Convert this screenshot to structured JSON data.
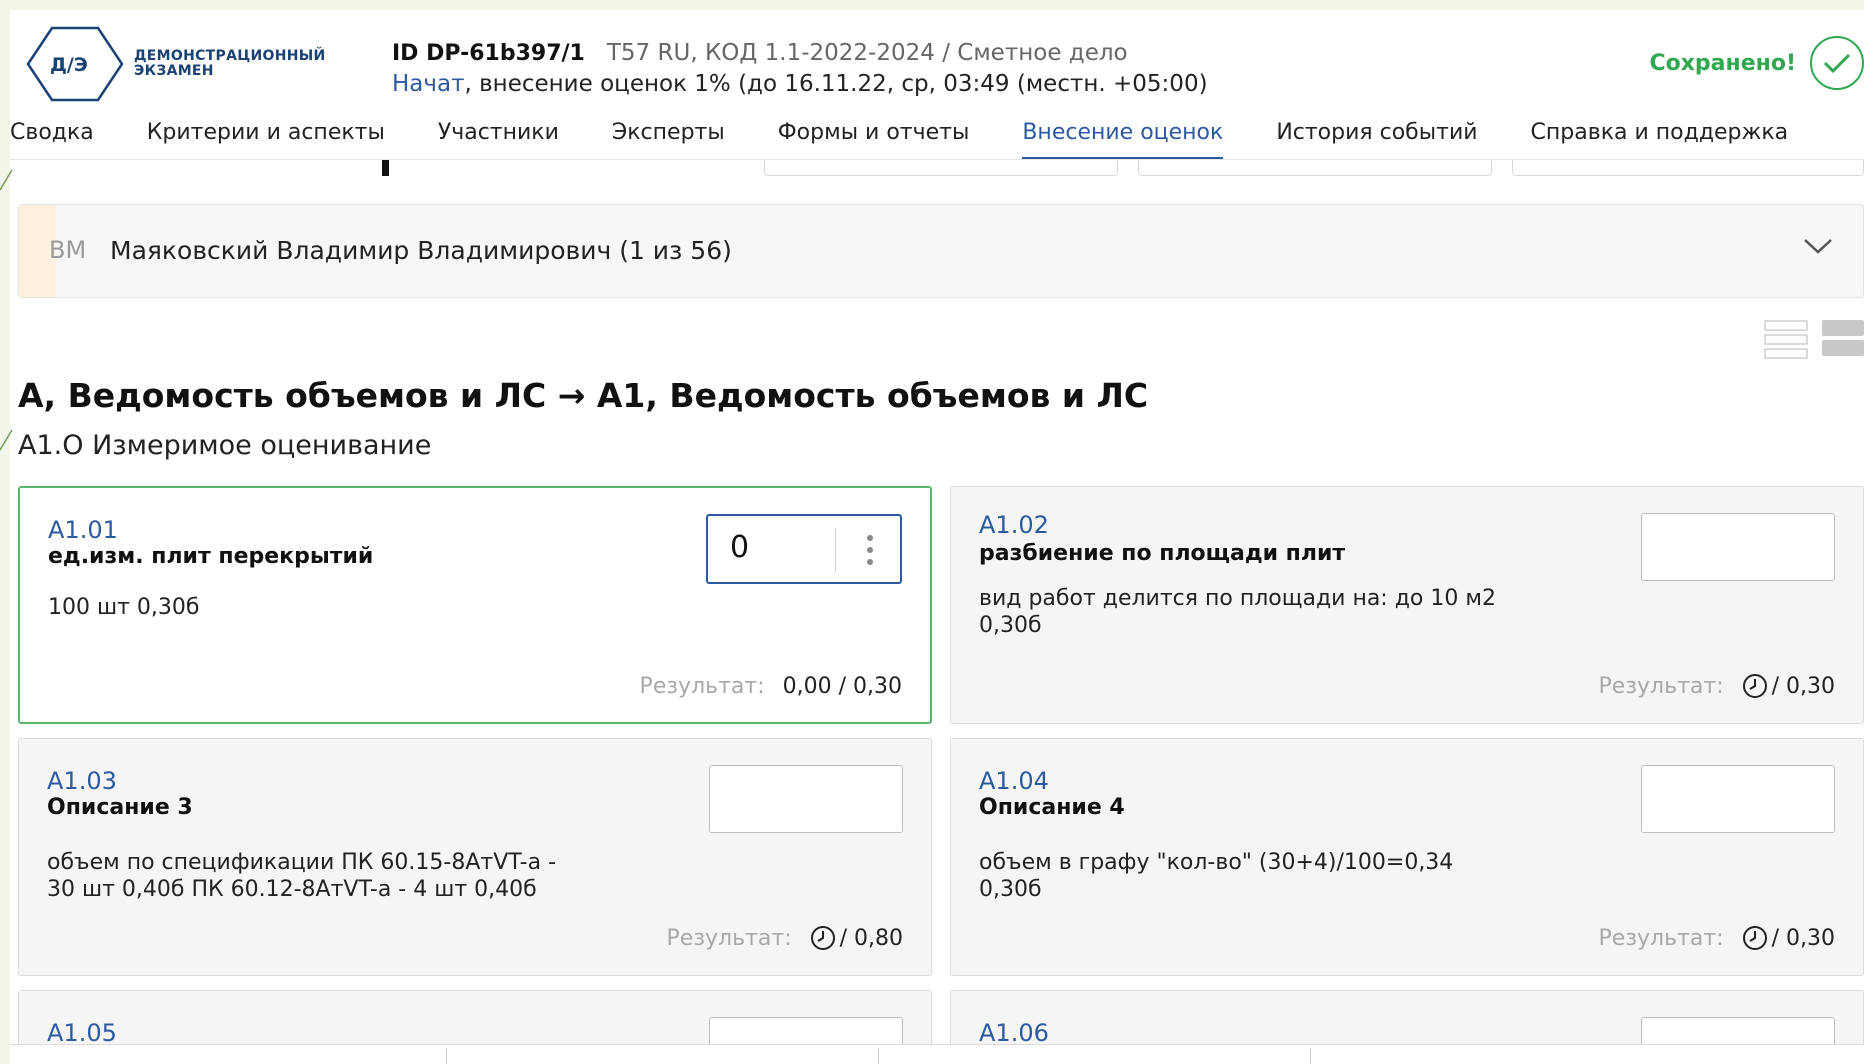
{
  "header": {
    "logo_text_line1": "ДЕМОНСТРАЦИОННЫЙ",
    "logo_text_line2": "ЭКЗАМЕН",
    "logo_mark": "Д/Э",
    "exam_id": "ID DP-61b397/1",
    "exam_meta": "T57 RU, КОД 1.1-2022-2024 / Сметное дело",
    "status": "Начат",
    "status_detail": ", внесение оценок 1% (до 16.11.22, ср, 03:49 (местн. +05:00)",
    "saved_label": "Сохранено!",
    "saved_icon": "check-circle-icon"
  },
  "nav": {
    "tabs": [
      {
        "label": "Сводка"
      },
      {
        "label": "Критерии и аспекты"
      },
      {
        "label": "Участники"
      },
      {
        "label": "Эксперты"
      },
      {
        "label": "Формы и отчеты"
      },
      {
        "label": "Внесение оценок",
        "active": true
      },
      {
        "label": "История событий"
      },
      {
        "label": "Справка и поддержка"
      }
    ]
  },
  "participant": {
    "initials": "ВМ",
    "name": "Маяковский Владимир Владимирович (1 из 56)"
  },
  "section": {
    "title": "А, Ведомость объемов и ЛС → А1, Ведомость объемов и ЛС",
    "subtitle": "А1.О Измеримое оценивание"
  },
  "cards": [
    {
      "code": "А1.01",
      "title": "ед.изм. плит перекрытий",
      "desc": "100 шт 0,30б",
      "input_value": "0",
      "result_label": "Результат:",
      "result_value": "0,00 / 0,30"
    },
    {
      "code": "А1.02",
      "title": "разбиение по площади плит",
      "desc": "вид работ делится по площади на: до 10 м2 0,30б",
      "input_value": "",
      "result_label": "Результат:",
      "result_value": "/ 0,30"
    },
    {
      "code": "А1.03",
      "title": "Описание 3",
      "desc": "объем по спецификации ПК 60.15-8АтVT-а - 30 шт 0,40б ПК 60.12-8АтVT-а - 4 шт 0,40б",
      "input_value": "",
      "result_label": "Результат:",
      "result_value": "/ 0,80"
    },
    {
      "code": "А1.04",
      "title": "Описание 4",
      "desc": "объем в графу \"кол-во\" (30+4)/100=0,34 0,30б",
      "input_value": "",
      "result_label": "Результат:",
      "result_value": "/ 0,30"
    },
    {
      "code": "А1.05"
    },
    {
      "code": "А1.06"
    }
  ],
  "colors": {
    "accent": "#2c5aa0",
    "success": "#2fa84f",
    "active_card_border": "#5bb56e",
    "logo": "#1a4272"
  }
}
